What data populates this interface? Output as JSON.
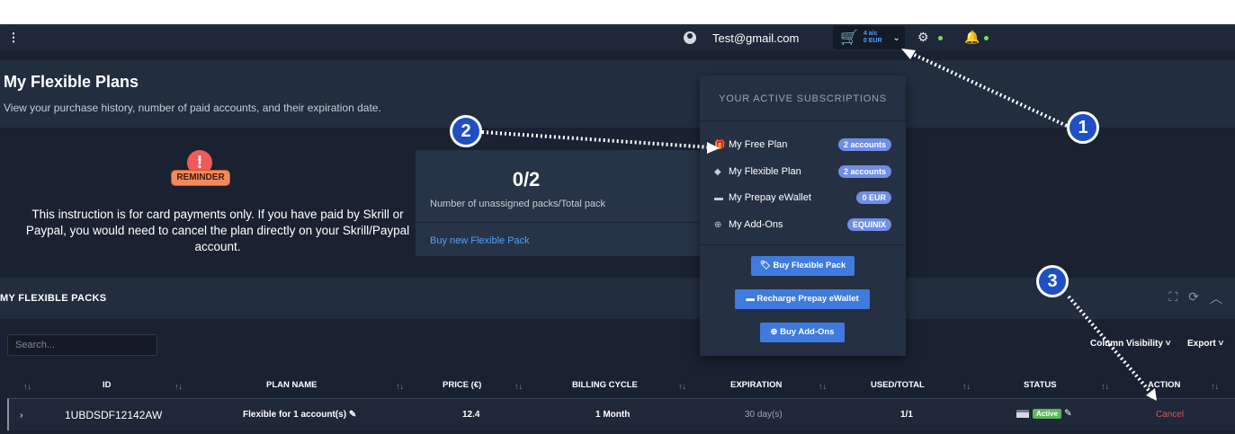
{
  "topbar": {
    "menu_icon": "vertical-dots-icon",
    "user_email": "Test@gmail.com",
    "cart": {
      "accounts": "4 a/c",
      "amount": "0 EUR"
    }
  },
  "page": {
    "title": "My Flexible Plans",
    "subtitle": "View your purchase history, number of paid accounts, and their expiration date."
  },
  "reminder": {
    "badge": "REMINDER",
    "text": "This instruction is for card payments only. If you have paid by Skrill or Paypal, you would need to cancel the plan directly on your Skrill/Paypal account."
  },
  "stat": {
    "value": "0/2",
    "label": "Number of unassigned packs/Total pack",
    "link": "Buy new Flexible Pack"
  },
  "packs": {
    "title": "MY FLEXIBLE PACKS",
    "search_placeholder": "Search...",
    "column_visibility": "Column Visibility",
    "export": "Export",
    "columns": [
      "ID",
      "PLAN NAME",
      "PRICE (€)",
      "BILLING CYCLE",
      "EXPIRATION",
      "USED/TOTAL",
      "STATUS",
      "ACTION"
    ],
    "rows": [
      {
        "id": "1UBDSDF12142AW",
        "plan_name": "Flexible for 1 account(s)",
        "price": "12.4",
        "billing_cycle": "1 Month",
        "expiration": "30 day(s)",
        "used_total": "1/1",
        "status": "Active",
        "action": "Cancel"
      }
    ]
  },
  "dropdown": {
    "title": "YOUR ACTIVE SUBSCRIPTIONS",
    "items": [
      {
        "label": "My Free Plan",
        "badge": "2 accounts"
      },
      {
        "label": "My Flexible Plan",
        "badge": "2 accounts"
      },
      {
        "label": "My Prepay eWallet",
        "badge": "0 EUR"
      },
      {
        "label": "My Add-Ons",
        "badge": "EQUINIX"
      }
    ],
    "buttons": [
      "Buy Flexible Pack",
      "Recharge Prepay eWallet",
      "Buy Add-Ons"
    ]
  },
  "annotations": [
    "1",
    "2",
    "3"
  ],
  "colors": {
    "background": "#1a2231",
    "panel": "#222d3e",
    "accent_blue": "#3f7bde",
    "badge_blue": "#6f8ee6",
    "active_green": "#5cb85c",
    "cancel_red": "#e05555"
  }
}
